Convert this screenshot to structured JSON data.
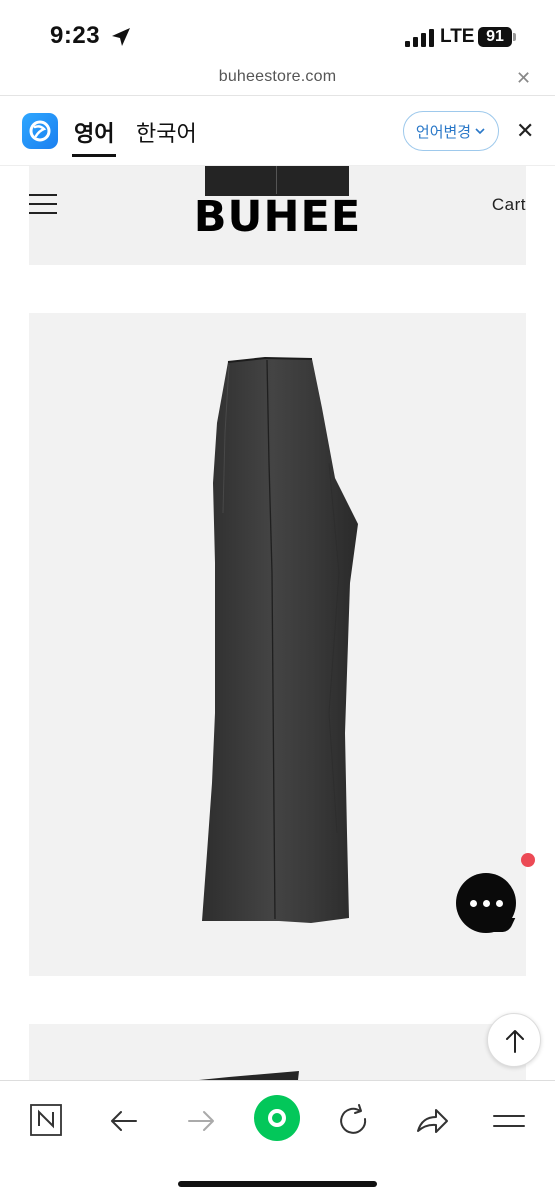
{
  "status_bar": {
    "time": "9:23",
    "network": "LTE",
    "battery": "91"
  },
  "url_bar": {
    "domain": "buheestore.com",
    "close_icon": "close-icon"
  },
  "translate_bar": {
    "logo_icon": "translate-app-icon",
    "tab_english": "영어",
    "tab_korean": "한국어",
    "change_language": "언어변경",
    "accent_color": "#2a78c8"
  },
  "site_header": {
    "logo": "BUHEE",
    "cart": "Cart",
    "menu_icon": "hamburger-menu-icon"
  },
  "product": {
    "image_description_icon": "dark-flared-trousers-image",
    "garment_color": "#3b3b3b"
  },
  "floating": {
    "chat_icon": "chat-bubble-icon",
    "notification_color": "#ec4a55",
    "scroll_top_icon": "arrow-up-icon"
  },
  "toolbar": {
    "icons": [
      "naver-n-icon",
      "back-arrow-icon",
      "forward-arrow-icon",
      "green-circle-home-icon",
      "refresh-icon",
      "share-icon",
      "menu-icon"
    ],
    "green_color": "#03c75a"
  }
}
